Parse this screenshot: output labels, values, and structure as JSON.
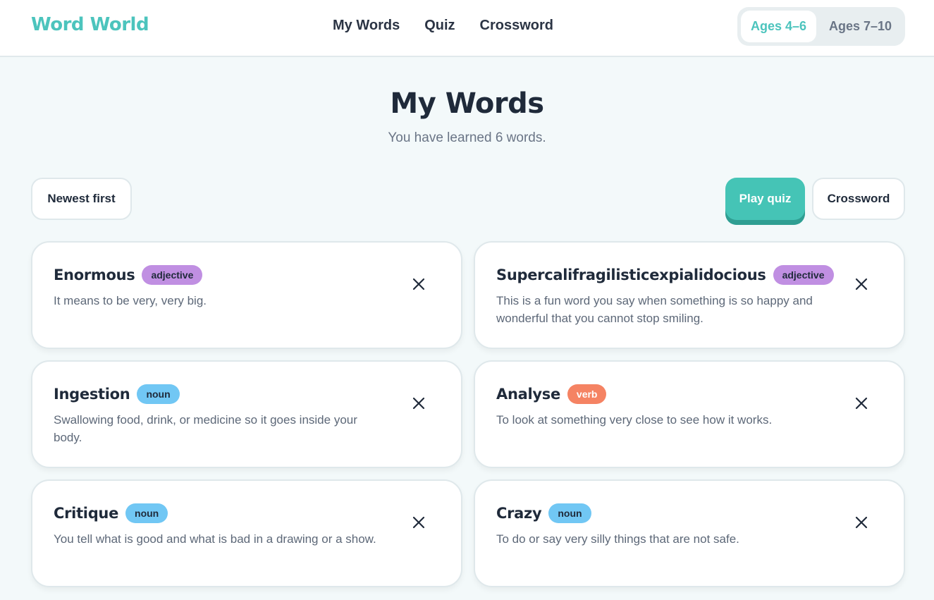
{
  "header": {
    "logo": "Word World",
    "nav": [
      "My Words",
      "Quiz",
      "Crossword"
    ],
    "age_options": [
      "Ages 4–6",
      "Ages 7–10"
    ],
    "age_selected": "Ages 4–6"
  },
  "main": {
    "title": "My Words",
    "subtitle": "You have learned 6 words.",
    "sort_label": "Newest first",
    "quiz_label": "Play quiz",
    "crossword_label": "Crossword"
  },
  "words": [
    {
      "word": "Enormous",
      "type": "adjective",
      "definition": "It means to be very, very big."
    },
    {
      "word": "Supercalifragilisticexpialidocious",
      "type": "adjective",
      "definition": "This is a fun word you say when something is so happy and wonderful that you cannot stop smiling."
    },
    {
      "word": "Ingestion",
      "type": "noun",
      "definition": "Swallowing food, drink, or medicine so it goes inside your body."
    },
    {
      "word": "Analyse",
      "type": "verb",
      "definition": "To look at something very close to see how it works."
    },
    {
      "word": "Critique",
      "type": "noun",
      "definition": "You tell what is good and what is bad in a drawing or a show."
    },
    {
      "word": "Crazy",
      "type": "noun",
      "definition": "To do or say very silly things that are not safe."
    }
  ],
  "colors": {
    "brand": "#4cc4bd",
    "quiz_button": "#45c4b6",
    "adjective": "#c08fe2",
    "noun": "#71c7f4",
    "verb": "#f58363"
  },
  "icons": {
    "delete": "close-icon"
  }
}
